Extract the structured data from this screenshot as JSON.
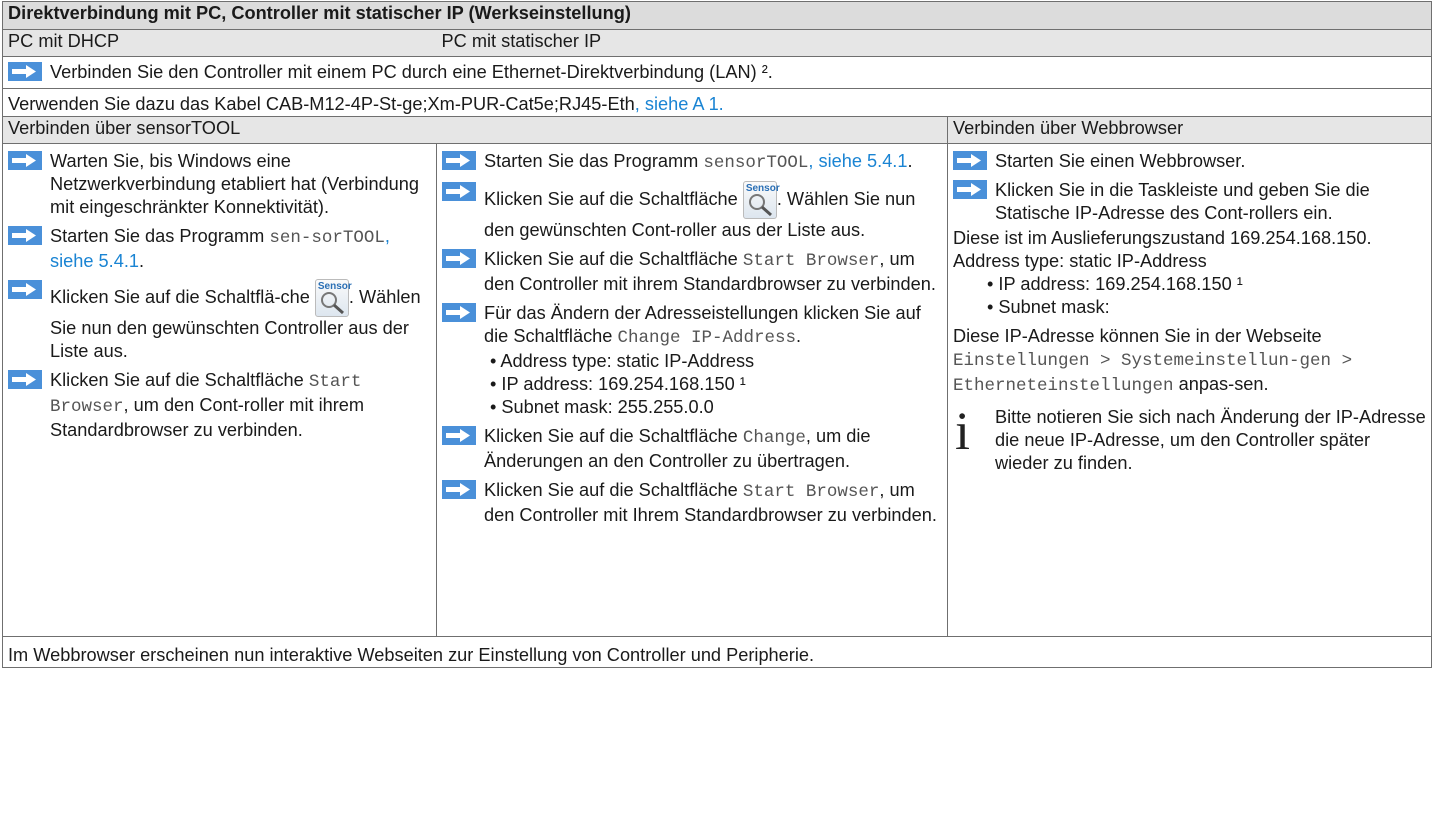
{
  "title": "Direktverbindung mit PC, Controller mit statischer IP (Werkseinstellung)",
  "pc_dhcp": "PC mit DHCP",
  "pc_static": "PC mit statischer IP",
  "connect_lan": "Verbinden Sie den Controller mit einem PC durch eine Ethernet-Direktverbindung (LAN) ²",
  "connect_lan_end": ".",
  "cable_text": "Verwenden Sie dazu das Kabel CAB-M12-4P-St-ge;Xm-PUR-Cat5e;RJ45-Eth",
  "cable_ref": ", siehe A 1.",
  "via_sensortool": "Verbinden über sensorTOOL",
  "via_browser": "Verbinden über Webbrowser",
  "sensor_icon_text": "Sensor",
  "col1": {
    "s1": "Warten Sie, bis Windows eine Netzwerkverbindung etabliert hat (Verbindung mit eingeschränkter Konnektivität).",
    "s2_a": "Starten Sie das Programm ",
    "s2_mono": "sen-sorTOOL",
    "s2_ref": ", siehe 5.4.1",
    "s2_end": ".",
    "s3_a": "Klicken Sie auf die Schaltflä-che ",
    "s3_b": ". Wählen Sie nun den gewünschten Controller aus der Liste aus.",
    "s4_a": "Klicken Sie auf die Schaltfläche ",
    "s4_mono": "Start Browser",
    "s4_b": ", um den Cont-roller mit ihrem Standardbrowser zu verbinden."
  },
  "col2": {
    "s1_a": "Starten Sie das Programm ",
    "s1_mono": "sensorTOOL",
    "s1_ref": ", siehe 5.4.1",
    "s1_end": ".",
    "s2_a": "Klicken Sie auf die Schaltfläche ",
    "s2_b": ". Wählen Sie nun den gewünschten Cont-roller aus der Liste aus.",
    "s3_a": "Klicken Sie auf die Schaltfläche ",
    "s3_mono": "Start Browser",
    "s3_b": ", um den Controller mit ihrem Standardbrowser zu verbinden.",
    "s4_a": "Für das Ändern der Adresseistellungen klicken Sie auf die Schaltfläche ",
    "s4_mono": "Change IP-Address",
    "s4_end": ".",
    "b1": "• Address type: static IP-Address",
    "b2": "• IP address: 169.254.168.150 ¹",
    "b3": "• Subnet mask: 255.255.0.0",
    "s5_a": "Klicken Sie auf die Schaltfläche ",
    "s5_mono": "Change",
    "s5_b": ", um die Änderungen an den Controller zu übertragen.",
    "s6_a": "Klicken Sie auf die Schaltfläche ",
    "s6_mono": "Start Browser",
    "s6_b": ", um den Controller mit Ihrem Standardbrowser zu verbinden."
  },
  "col3": {
    "s1": "Starten Sie einen Webbrowser.",
    "s2": "Klicken Sie in die Taskleiste und geben Sie die Statische IP-Adresse des Cont-rollers ein.",
    "p1": "Diese ist im Auslieferungszustand 169.254.168.150.",
    "p2": "Address type: static IP-Address",
    "b1": "• IP address: 169.254.168.150 ¹",
    "b2": "• Subnet mask:",
    "p3_a": "Diese IP-Adresse können Sie in der Webseite ",
    "p3_mono": "Einstellungen > Systemeinstellun-gen > Etherneteinstellungen",
    "p3_b": " anpas-sen.",
    "info_icon": "i",
    "info": "Bitte notieren Sie sich nach Änderung der IP-Adresse die neue IP-Adresse, um den Controller später wieder zu finden."
  },
  "footer": "Im Webbrowser erscheinen nun interaktive Webseiten zur Einstellung von Controller und Peripherie.",
  "colors": {
    "arrow": "#4a90d9",
    "link": "#1a84d3",
    "header_bg": "#dcdcdc",
    "strip_bg": "#e6e6e6"
  }
}
